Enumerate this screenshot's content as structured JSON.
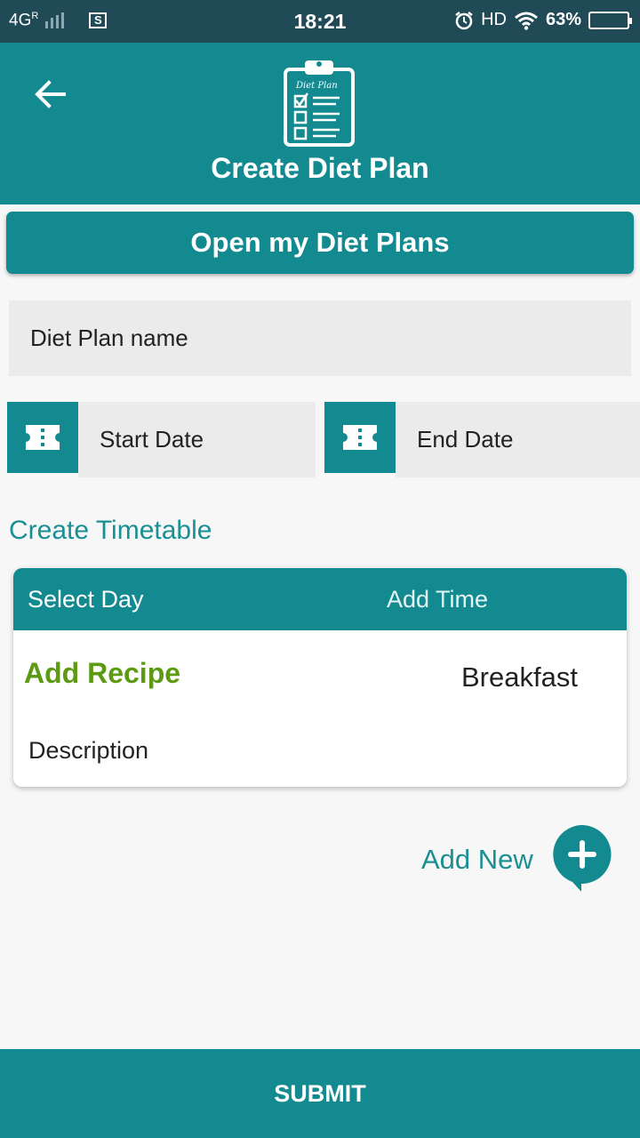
{
  "status_bar": {
    "network": "4G",
    "roaming": "R",
    "time": "18:21",
    "hd": "HD",
    "battery": "63%"
  },
  "header": {
    "title": "Create Diet Plan",
    "clipboard_text": "Diet Plan"
  },
  "open_button": {
    "label": "Open my Diet Plans"
  },
  "form": {
    "name_placeholder": "Diet Plan name",
    "start_date_placeholder": "Start Date",
    "end_date_placeholder": "End Date"
  },
  "timetable": {
    "title": "Create Timetable",
    "select_day": "Select Day",
    "add_time": "Add Time",
    "add_recipe": "Add Recipe",
    "meal": "Breakfast",
    "description": "Description"
  },
  "add_new": {
    "label": "Add New"
  },
  "submit": {
    "label": "SUBMIT"
  },
  "colors": {
    "primary": "#128a90",
    "status_bar": "#1f4a56",
    "recipe_green": "#5b9a11",
    "field_bg": "#ebebeb"
  },
  "icons": [
    "back-arrow-icon",
    "clipboard-checklist-icon",
    "ticket-icon",
    "plus-chat-icon",
    "alarm-icon",
    "wifi-icon",
    "battery-icon"
  ]
}
